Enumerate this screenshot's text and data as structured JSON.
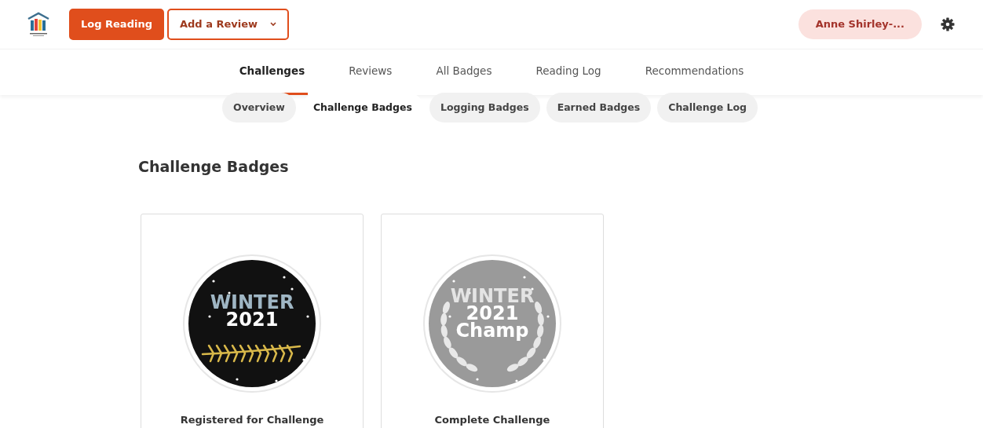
{
  "header": {
    "buttons": [
      {
        "label": "Log Reading",
        "kind": "primary"
      },
      {
        "label": "Add a Review",
        "kind": "dropdown"
      }
    ],
    "user": {
      "label": "Anne Shirley-..."
    }
  },
  "tabs": [
    {
      "label": "Challenges",
      "selected": true
    },
    {
      "label": "Reviews",
      "selected": false
    },
    {
      "label": "All Badges",
      "selected": false
    },
    {
      "label": "Reading Log",
      "selected": false
    },
    {
      "label": "Recommendations",
      "selected": false
    }
  ],
  "subtabs": [
    {
      "label": "Overview",
      "selected": false
    },
    {
      "label": "Challenge Badges",
      "selected": true
    },
    {
      "label": "Logging Badges",
      "selected": false
    },
    {
      "label": "Earned Badges",
      "selected": false
    },
    {
      "label": "Challenge Log",
      "selected": false
    }
  ],
  "heading": "Challenge Badges",
  "badges": [
    {
      "lines": [
        "WINTER",
        "2021"
      ],
      "kind": "registered",
      "earned": true,
      "caption": "Registered for Challenge"
    },
    {
      "lines": [
        "WINTER",
        "2021",
        "Champ"
      ],
      "kind": "champ",
      "earned": false,
      "caption": "Complete Challenge"
    }
  ]
}
